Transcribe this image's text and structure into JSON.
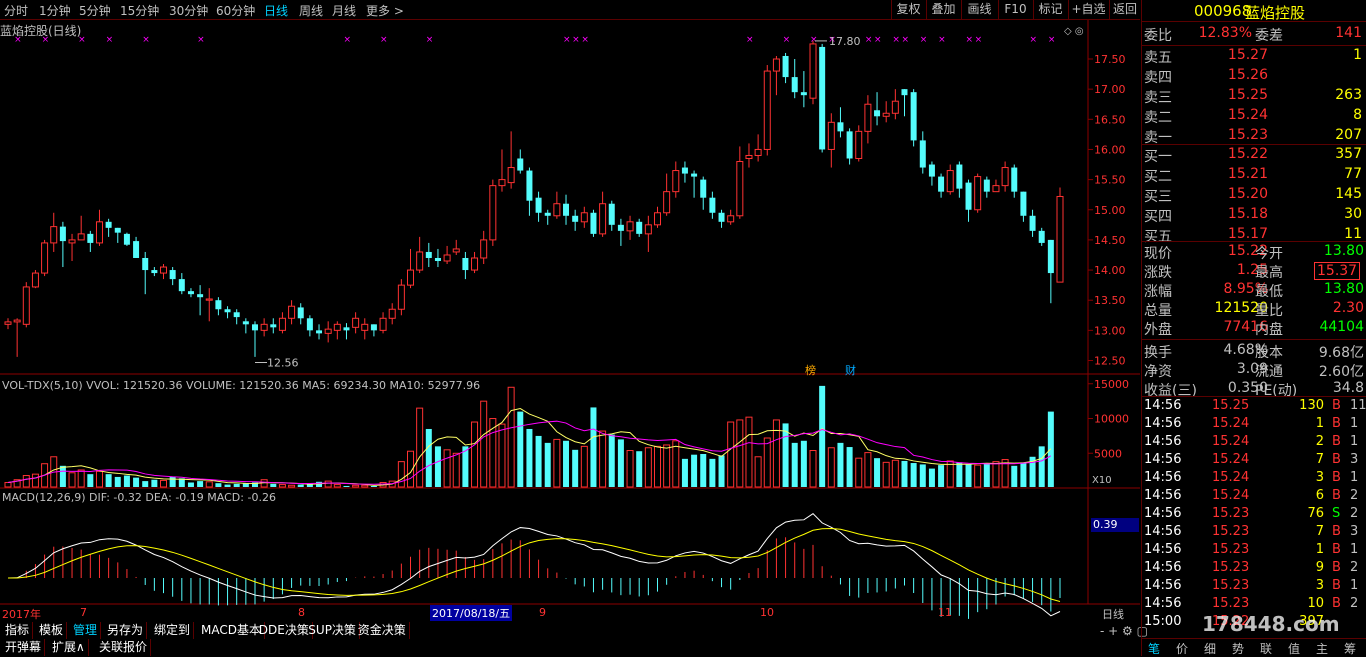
{
  "toolbar": {
    "periods": [
      "分时",
      "1分钟",
      "5分钟",
      "15分钟",
      "30分钟",
      "60分钟",
      "日线",
      "周线",
      "月线",
      "更多 >"
    ],
    "active_period": "日线",
    "buttons": [
      "复权",
      "叠加",
      "画线",
      "F10",
      "标记",
      "+自选",
      "返回"
    ]
  },
  "chart": {
    "title": "蓝焰控股(日线)",
    "price_ticks": [
      "17.50",
      "17.00",
      "16.50",
      "16.00",
      "15.50",
      "15.00",
      "14.50",
      "14.00",
      "13.50",
      "13.00",
      "12.50"
    ],
    "high_marker": "17.80",
    "low_marker": "12.56",
    "badges": [
      "榜",
      "财"
    ],
    "candles": [
      [
        13.1,
        13.14,
        13.2,
        13.02
      ],
      [
        13.14,
        13.17,
        13.2,
        12.56
      ],
      [
        13.1,
        13.72,
        13.8,
        13.05
      ],
      [
        13.72,
        13.95,
        14.0,
        13.7
      ],
      [
        13.95,
        14.45,
        14.5,
        13.9
      ],
      [
        14.45,
        14.72,
        14.95,
        14.3
      ],
      [
        14.72,
        14.48,
        14.8,
        14.05
      ],
      [
        14.45,
        14.5,
        14.6,
        14.15
      ],
      [
        14.5,
        14.6,
        14.9,
        14.5
      ],
      [
        14.6,
        14.45,
        14.65,
        14.3
      ],
      [
        14.45,
        14.8,
        15.0,
        14.4
      ],
      [
        14.8,
        14.7,
        14.85,
        14.55
      ],
      [
        14.7,
        14.62,
        14.7,
        14.45
      ],
      [
        14.6,
        14.42,
        14.62,
        14.4
      ],
      [
        14.48,
        14.2,
        14.55,
        14.2
      ],
      [
        14.2,
        14.0,
        14.3,
        13.6
      ],
      [
        14.0,
        13.95,
        14.05,
        13.9
      ],
      [
        13.95,
        14.05,
        14.1,
        13.85
      ],
      [
        14.0,
        13.85,
        14.05,
        13.75
      ],
      [
        13.85,
        13.65,
        13.95,
        13.6
      ],
      [
        13.65,
        13.6,
        13.7,
        13.55
      ],
      [
        13.6,
        13.55,
        13.75,
        13.25
      ],
      [
        13.5,
        13.52,
        13.7,
        13.15
      ],
      [
        13.5,
        13.35,
        13.55,
        13.25
      ],
      [
        13.35,
        13.3,
        13.4,
        13.2
      ],
      [
        13.3,
        13.22,
        13.35,
        13.1
      ],
      [
        13.15,
        13.1,
        13.2,
        12.95
      ],
      [
        13.1,
        13.0,
        13.15,
        12.56
      ],
      [
        13.0,
        13.1,
        13.2,
        12.9
      ],
      [
        13.1,
        13.05,
        13.2,
        12.95
      ],
      [
        13.0,
        13.2,
        13.3,
        12.95
      ],
      [
        13.2,
        13.4,
        13.5,
        13.1
      ],
      [
        13.38,
        13.2,
        13.45,
        13.1
      ],
      [
        13.2,
        13.0,
        13.25,
        12.9
      ],
      [
        13.0,
        12.95,
        13.1,
        12.85
      ],
      [
        12.95,
        13.02,
        13.15,
        12.8
      ],
      [
        13.0,
        13.1,
        13.15,
        12.85
      ],
      [
        13.05,
        13.0,
        13.12,
        12.85
      ],
      [
        13.05,
        13.2,
        13.3,
        12.95
      ],
      [
        13.0,
        13.1,
        13.2,
        12.85
      ],
      [
        13.1,
        13.0,
        13.1,
        12.9
      ],
      [
        13.0,
        13.2,
        13.3,
        12.95
      ],
      [
        13.2,
        13.35,
        13.45,
        13.1
      ],
      [
        13.35,
        13.75,
        13.85,
        13.25
      ],
      [
        13.75,
        14.0,
        14.35,
        13.7
      ],
      [
        14.0,
        14.3,
        14.55,
        13.95
      ],
      [
        14.3,
        14.2,
        14.45,
        14.05
      ],
      [
        14.2,
        14.15,
        14.35,
        14.05
      ],
      [
        14.15,
        14.25,
        14.4,
        14.1
      ],
      [
        14.3,
        14.35,
        14.5,
        14.25
      ],
      [
        14.2,
        14.0,
        14.3,
        13.85
      ],
      [
        14.0,
        14.2,
        14.3,
        13.95
      ],
      [
        14.2,
        14.5,
        14.65,
        14.1
      ],
      [
        14.5,
        15.4,
        15.5,
        14.4
      ],
      [
        15.4,
        15.5,
        16.0,
        15.3
      ],
      [
        15.45,
        15.7,
        16.3,
        15.35
      ],
      [
        15.85,
        15.65,
        16.0,
        15.6
      ],
      [
        15.65,
        15.15,
        15.7,
        14.9
      ],
      [
        15.2,
        14.95,
        15.3,
        14.8
      ],
      [
        14.95,
        14.9,
        15.0,
        14.75
      ],
      [
        14.9,
        15.1,
        15.3,
        14.85
      ],
      [
        15.1,
        14.9,
        15.25,
        14.75
      ],
      [
        14.9,
        14.8,
        15.0,
        14.65
      ],
      [
        14.8,
        14.95,
        15.05,
        14.7
      ],
      [
        14.95,
        14.6,
        15.0,
        14.55
      ],
      [
        14.6,
        15.1,
        15.3,
        14.55
      ],
      [
        15.1,
        14.75,
        15.15,
        14.65
      ],
      [
        14.75,
        14.65,
        14.85,
        14.4
      ],
      [
        14.65,
        14.8,
        14.9,
        14.5
      ],
      [
        14.8,
        14.6,
        14.85,
        14.55
      ],
      [
        14.6,
        14.75,
        14.9,
        14.3
      ],
      [
        14.75,
        14.95,
        15.05,
        14.7
      ],
      [
        14.95,
        15.3,
        15.6,
        14.9
      ],
      [
        15.3,
        15.65,
        15.8,
        15.2
      ],
      [
        15.7,
        15.6,
        15.8,
        15.45
      ],
      [
        15.6,
        15.55,
        15.65,
        15.2
      ],
      [
        15.5,
        15.2,
        15.55,
        15.0
      ],
      [
        15.2,
        14.95,
        15.3,
        14.85
      ],
      [
        14.95,
        14.8,
        15.0,
        14.7
      ],
      [
        14.8,
        14.9,
        15.0,
        14.75
      ],
      [
        14.9,
        15.8,
        16.05,
        14.85
      ],
      [
        15.85,
        15.9,
        16.1,
        15.7
      ],
      [
        15.9,
        16.0,
        16.25,
        15.8
      ],
      [
        16.0,
        17.3,
        17.4,
        15.9
      ],
      [
        17.3,
        17.5,
        17.55,
        16.9
      ],
      [
        17.55,
        17.2,
        17.6,
        17.1
      ],
      [
        17.2,
        16.95,
        17.5,
        16.85
      ],
      [
        16.95,
        16.9,
        17.3,
        16.7
      ],
      [
        16.85,
        17.75,
        17.8,
        16.75
      ],
      [
        17.7,
        16.0,
        17.75,
        15.95
      ],
      [
        16.0,
        16.45,
        16.6,
        15.7
      ],
      [
        16.45,
        16.3,
        16.7,
        16.2
      ],
      [
        16.3,
        15.85,
        16.35,
        15.75
      ],
      [
        15.85,
        16.3,
        16.4,
        15.8
      ],
      [
        16.3,
        16.75,
        16.9,
        16.1
      ],
      [
        16.65,
        16.55,
        16.95,
        16.4
      ],
      [
        16.55,
        16.6,
        16.8,
        16.45
      ],
      [
        16.6,
        16.8,
        17.0,
        16.5
      ],
      [
        17.0,
        16.9,
        17.0,
        16.55
      ],
      [
        16.95,
        16.15,
        17.0,
        16.05
      ],
      [
        16.15,
        15.7,
        16.3,
        15.6
      ],
      [
        15.75,
        15.55,
        15.8,
        15.4
      ],
      [
        15.55,
        15.3,
        15.6,
        15.2
      ],
      [
        15.3,
        15.65,
        15.75,
        15.25
      ],
      [
        15.75,
        15.35,
        15.8,
        15.2
      ],
      [
        15.45,
        15.0,
        15.5,
        14.8
      ],
      [
        15.0,
        15.55,
        15.6,
        14.95
      ],
      [
        15.5,
        15.3,
        15.55,
        15.2
      ],
      [
        15.3,
        15.4,
        15.5,
        15.3
      ],
      [
        15.4,
        15.7,
        15.8,
        15.3
      ],
      [
        15.7,
        15.3,
        15.75,
        15.2
      ],
      [
        15.3,
        14.9,
        15.3,
        14.8
      ],
      [
        14.9,
        14.65,
        15.0,
        14.55
      ],
      [
        14.65,
        14.45,
        14.7,
        14.4
      ],
      [
        14.5,
        13.95,
        14.5,
        13.45
      ],
      [
        13.8,
        15.22,
        15.37,
        13.8
      ]
    ],
    "volumes": [
      1800,
      2200,
      2800,
      3000,
      4500,
      5500,
      4200,
      3200,
      3600,
      3000,
      3400,
      3000,
      2600,
      2800,
      2500,
      2000,
      2200,
      2100,
      2600,
      2400,
      1800,
      2000,
      1900,
      1700,
      1500,
      1600,
      1700,
      1800,
      2200,
      1600,
      1500,
      1400,
      1500,
      1700,
      1900,
      2000,
      1500,
      1300,
      1400,
      1400,
      1300,
      1800,
      2000,
      4800,
      6300,
      12500,
      9500,
      7000,
      6500,
      6000,
      7000,
      10500,
      13500,
      11000,
      10200,
      15500,
      12000,
      9500,
      8500,
      7500,
      8000,
      7800,
      6500,
      7000,
      12600,
      9200,
      8700,
      8000,
      6400,
      6300,
      6800,
      7000,
      7200,
      7800,
      5200,
      5800,
      5900,
      5200,
      5700,
      10500,
      10800,
      11200,
      5500,
      8200,
      10800,
      10300,
      7500,
      7800,
      6400,
      15700,
      6800,
      7500,
      6900,
      5300,
      6100,
      5300,
      4700,
      5000,
      4900,
      4600,
      4400,
      3800,
      4300,
      4900,
      4700,
      4400,
      4300,
      4500,
      4800,
      5100,
      4200,
      4600,
      5500,
      7000,
      12000
    ],
    "vol_legend": "VOL-TDX(5,10)  VVOL: 121520.36  VOLUME: 121520.36  MA5: 69234.30  MA10: 52977.96",
    "vol_ticks": [
      "15000",
      "10000",
      "5000"
    ],
    "vol_unit": "X10",
    "macd_legend": "MACD(12,26,9)  DIF: -0.32  DEA: -0.19  MACD: -0.26",
    "macd_value_box": "0.39",
    "date_labels": [
      "2017年",
      "7",
      "8",
      "2017/08/18/五",
      "9",
      "10",
      "11"
    ],
    "period_label": "日线"
  },
  "colors": {
    "up": "#ff3232",
    "down": "#54fcfc",
    "bg": "#000000",
    "grid": "#8b0000",
    "white": "#ffffff",
    "yellow": "#ffff00",
    "magenta": "#ff00ff"
  },
  "quote": {
    "code": "000968",
    "name": "蓝焰控股",
    "weibi_label": "委比",
    "weibi": "12.83%",
    "weicha_label": "委差",
    "weicha": "141",
    "asks": [
      [
        "卖五",
        "15.27",
        "1"
      ],
      [
        "卖四",
        "15.26",
        ""
      ],
      [
        "卖三",
        "15.25",
        "263"
      ],
      [
        "卖二",
        "15.24",
        "8"
      ],
      [
        "卖一",
        "15.23",
        "207"
      ]
    ],
    "bids": [
      [
        "买一",
        "15.22",
        "357"
      ],
      [
        "买二",
        "15.21",
        "77"
      ],
      [
        "买三",
        "15.20",
        "145"
      ],
      [
        "买四",
        "15.18",
        "30"
      ],
      [
        "买五",
        "15.17",
        "11"
      ]
    ],
    "stats": [
      [
        "现价",
        "15.22",
        "今开",
        "13.80"
      ],
      [
        "涨跌",
        "1.25",
        "最高",
        "15.37"
      ],
      [
        "涨幅",
        "8.95%",
        "最低",
        "13.80"
      ],
      [
        "总量",
        "121520",
        "量比",
        "2.30"
      ],
      [
        "外盘",
        "77416",
        "内盘",
        "44104"
      ],
      [
        "换手",
        "4.68%",
        "股本",
        "9.68亿"
      ],
      [
        "净资",
        "3.09",
        "流通",
        "2.60亿"
      ],
      [
        "收益(三)",
        "0.350",
        "PE(动)",
        "34.8"
      ]
    ],
    "trades": [
      [
        "14:56",
        "15.25",
        "130",
        "B",
        "11"
      ],
      [
        "14:56",
        "15.24",
        "1",
        "B",
        "1"
      ],
      [
        "14:56",
        "15.24",
        "2",
        "B",
        "1"
      ],
      [
        "14:56",
        "15.24",
        "7",
        "B",
        "3"
      ],
      [
        "14:56",
        "15.24",
        "3",
        "B",
        "1"
      ],
      [
        "14:56",
        "15.24",
        "6",
        "B",
        "2"
      ],
      [
        "14:56",
        "15.23",
        "76",
        "S",
        "2"
      ],
      [
        "14:56",
        "15.23",
        "7",
        "B",
        "3"
      ],
      [
        "14:56",
        "15.23",
        "1",
        "B",
        "1"
      ],
      [
        "14:56",
        "15.23",
        "9",
        "B",
        "2"
      ],
      [
        "14:56",
        "15.23",
        "3",
        "B",
        "1"
      ],
      [
        "14:56",
        "15.23",
        "10",
        "B",
        "2"
      ],
      [
        "15:00",
        "15.22",
        "397",
        "",
        ""
      ]
    ],
    "bottom_tabs": [
      "笔",
      "价",
      "细",
      "势",
      "联",
      "值",
      "主",
      "筹"
    ],
    "watermark": "178448.com"
  },
  "bottom": {
    "row1": [
      "指标",
      "模板",
      "管理",
      "另存为",
      "绑定到",
      "MACD基本",
      "DDE决策",
      "SUP决策",
      "资金决策"
    ],
    "row2": [
      "开弹幕",
      "扩展∧",
      "关联报价"
    ]
  }
}
